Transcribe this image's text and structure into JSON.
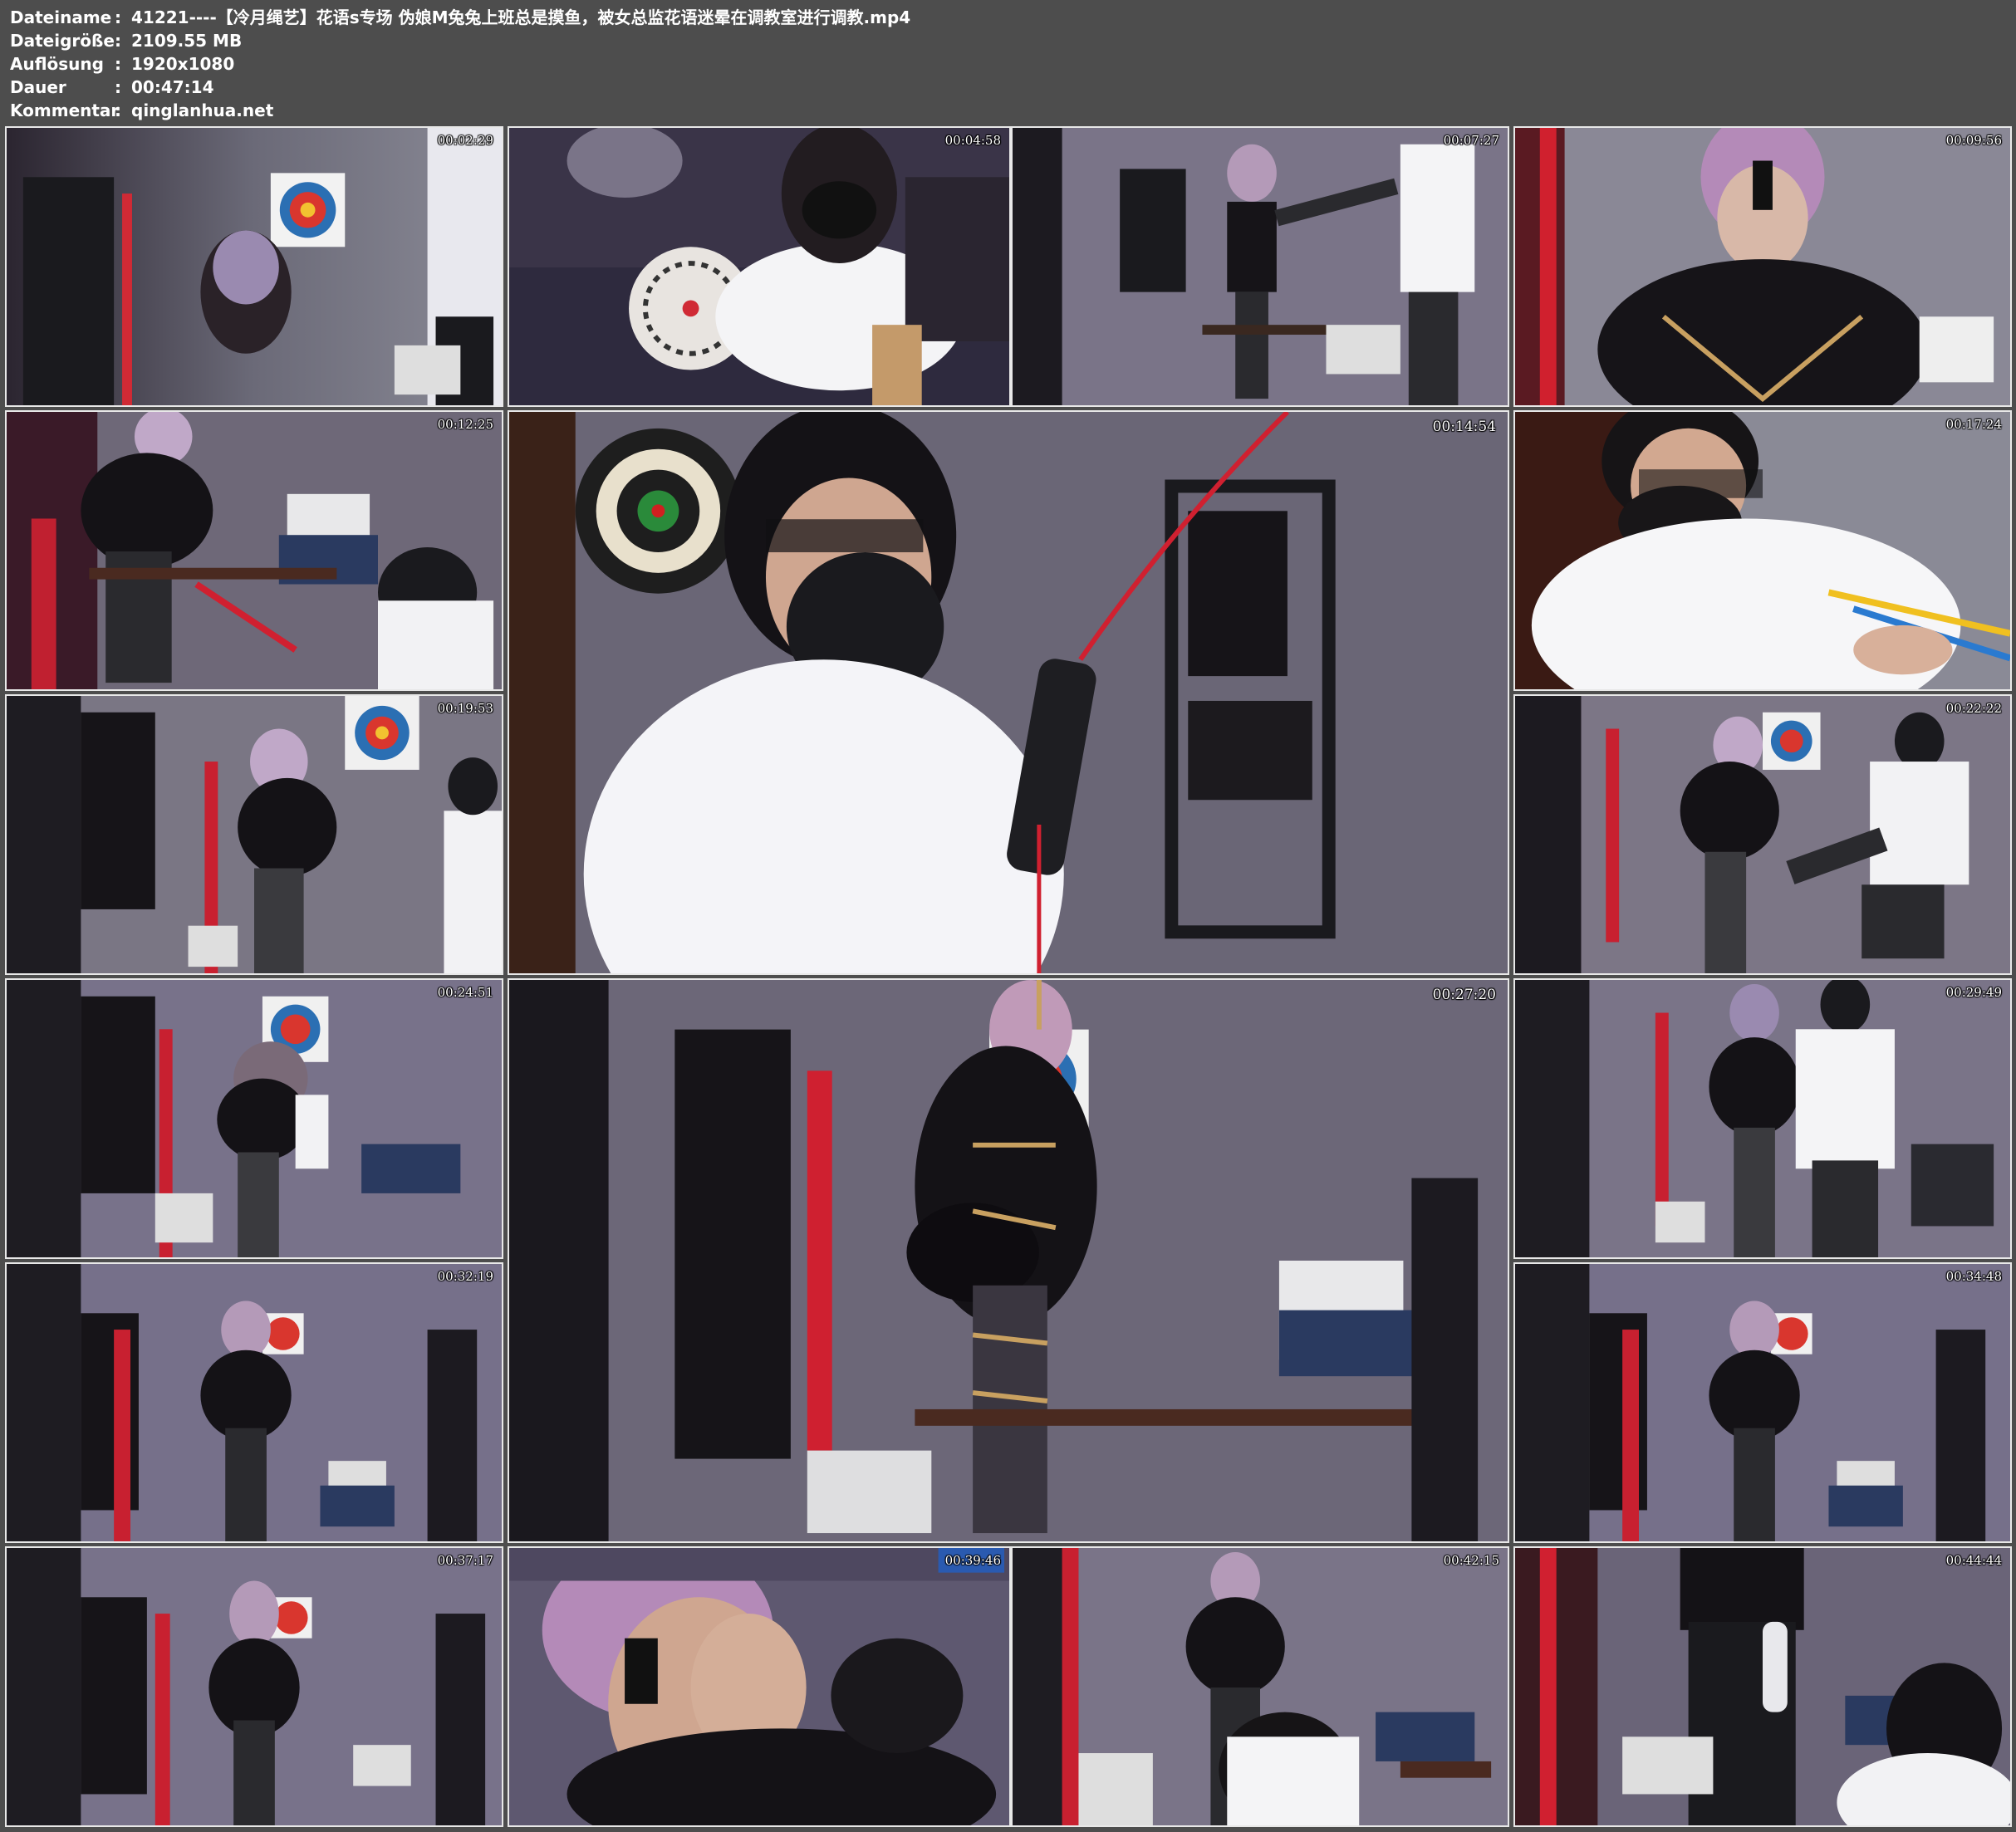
{
  "info": {
    "filename_label": "Dateiname",
    "filename": "41221----【冷月绳艺】花语s专场 伪娘M兔兔上班总是摸鱼，被女总监花语迷晕在调教室进行调教.mp4",
    "filesize_label": "Dateigröße",
    "filesize": "2109.55 MB",
    "resolution_label": "Auflösung",
    "resolution": "1920x1080",
    "duration_label": "Dauer",
    "duration": "00:47:14",
    "comment_label": "Kommentar",
    "comment": "qinglanhua.net",
    "separator": ":"
  },
  "thumbnails": [
    {
      "timestamp": "00:02:29"
    },
    {
      "timestamp": "00:04:58"
    },
    {
      "timestamp": "00:07:27"
    },
    {
      "timestamp": "00:09:56"
    },
    {
      "timestamp": "00:12:25"
    },
    {
      "timestamp": "00:14:54"
    },
    {
      "timestamp": "00:17:24"
    },
    {
      "timestamp": "00:19:53"
    },
    {
      "timestamp": "00:22:22"
    },
    {
      "timestamp": "00:24:51"
    },
    {
      "timestamp": "00:27:20"
    },
    {
      "timestamp": "00:29:49"
    },
    {
      "timestamp": "00:32:19"
    },
    {
      "timestamp": "00:34:48"
    },
    {
      "timestamp": "00:37:17"
    },
    {
      "timestamp": "00:39:46"
    },
    {
      "timestamp": "00:42:15"
    },
    {
      "timestamp": "00:44:44"
    }
  ]
}
